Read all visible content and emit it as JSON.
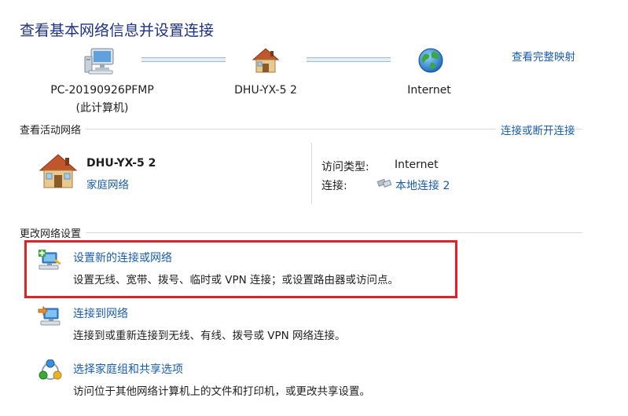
{
  "header": {
    "title": "查看基本网络信息并设置连接",
    "full_map_link": "查看完整映射"
  },
  "map": {
    "nodes": [
      {
        "name": "PC-20190926PFMP",
        "sub": "(此计算机)",
        "icon": "computer-icon"
      },
      {
        "name": "DHU-YX-5  2",
        "icon": "house-icon"
      },
      {
        "name": "Internet",
        "icon": "globe-icon"
      }
    ]
  },
  "active_networks": {
    "title": "查看活动网络",
    "action_link": "连接或断开连接",
    "network": {
      "name": "DHU-YX-5  2",
      "type_link": "家庭网络",
      "access_type_label": "访问类型:",
      "access_type_value": "Internet",
      "connection_label": "连接:",
      "connection_value": "本地连接 2"
    }
  },
  "change_settings": {
    "title": "更改网络设置",
    "tasks": [
      {
        "title": "设置新的连接或网络",
        "desc": "设置无线、宽带、拨号、临时或 VPN 连接；或设置路由器或访问点。",
        "icon": "new-connection-icon"
      },
      {
        "title": "连接到网络",
        "desc": "连接到或重新连接到无线、有线、拨号或 VPN 网络连接。",
        "icon": "connect-network-icon"
      },
      {
        "title": "选择家庭组和共享选项",
        "desc": "访问位于其他网络计算机上的文件和打印机，或更改共享设置。",
        "icon": "homegroup-icon"
      }
    ]
  },
  "colors": {
    "link": "#1a5dae",
    "title": "#1e3287",
    "highlight": "#e1202a"
  }
}
